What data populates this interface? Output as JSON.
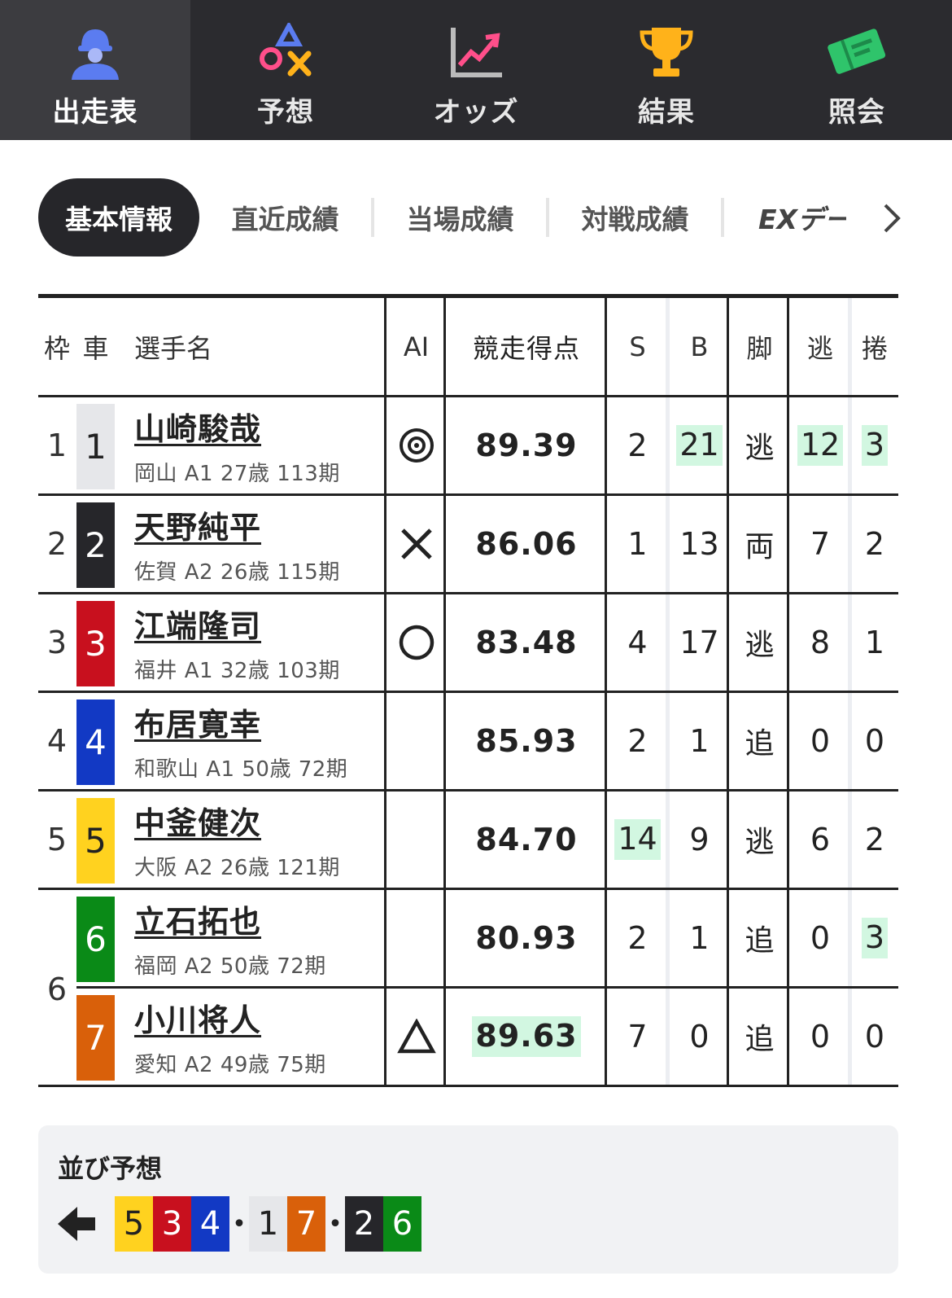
{
  "nav": {
    "items": [
      {
        "label": "出走表",
        "icon": "rider-icon",
        "active": true
      },
      {
        "label": "予想",
        "icon": "prediction-icon",
        "active": false
      },
      {
        "label": "オッズ",
        "icon": "odds-chart-icon",
        "active": false
      },
      {
        "label": "結果",
        "icon": "trophy-icon",
        "active": false
      },
      {
        "label": "照会",
        "icon": "ticket-icon",
        "active": false
      }
    ]
  },
  "subtabs": {
    "items": [
      "基本情報",
      "直近成績",
      "当場成績",
      "対戦成績",
      "EXデー"
    ],
    "active": "基本情報",
    "next_icon": "chevron-right-icon"
  },
  "table": {
    "headers": {
      "waku": "枠",
      "sha": "車",
      "name": "選手名",
      "ai": "AI",
      "score": "競走得点",
      "s": "S",
      "b": "B",
      "kyaku": "脚",
      "nige": "逃",
      "makuri": "捲"
    },
    "rows": [
      {
        "waku": "1",
        "sha": "1",
        "sha_bg": "#e6e7ea",
        "sha_fg": "#222222",
        "name": "山崎駿哉",
        "info": "岡山 A1 27歳 113期",
        "ai": "double-circle",
        "score": "89.39",
        "s": "2",
        "b": "21",
        "kyaku": "逃",
        "nige": "12",
        "makuri": "3",
        "hl": [
          "b",
          "nige",
          "makuri"
        ]
      },
      {
        "waku": "2",
        "sha": "2",
        "sha_bg": "#26262a",
        "sha_fg": "#ffffff",
        "name": "天野純平",
        "info": "佐賀 A2 26歳 115期",
        "ai": "cross",
        "score": "86.06",
        "s": "1",
        "b": "13",
        "kyaku": "両",
        "nige": "7",
        "makuri": "2",
        "hl": []
      },
      {
        "waku": "3",
        "sha": "3",
        "sha_bg": "#c8101e",
        "sha_fg": "#ffffff",
        "name": "江端隆司",
        "info": "福井 A1 32歳 103期",
        "ai": "circle",
        "score": "83.48",
        "s": "4",
        "b": "17",
        "kyaku": "逃",
        "nige": "8",
        "makuri": "1",
        "hl": []
      },
      {
        "waku": "4",
        "sha": "4",
        "sha_bg": "#1239c4",
        "sha_fg": "#ffffff",
        "name": "布居寛幸",
        "info": "和歌山 A1 50歳 72期",
        "ai": "",
        "score": "85.93",
        "s": "2",
        "b": "1",
        "kyaku": "追",
        "nige": "0",
        "makuri": "0",
        "hl": []
      },
      {
        "waku": "5",
        "sha": "5",
        "sha_bg": "#ffd21f",
        "sha_fg": "#222222",
        "name": "中釜健次",
        "info": "大阪 A2 26歳 121期",
        "ai": "",
        "score": "84.70",
        "s": "14",
        "b": "9",
        "kyaku": "逃",
        "nige": "6",
        "makuri": "2",
        "hl": [
          "s"
        ]
      },
      {
        "waku": "6",
        "sha": "6",
        "sha_bg": "#0a8a17",
        "sha_fg": "#ffffff",
        "name": "立石拓也",
        "info": "福岡 A2 50歳 72期",
        "ai": "",
        "score": "80.93",
        "s": "2",
        "b": "1",
        "kyaku": "追",
        "nige": "0",
        "makuri": "3",
        "hl": [
          "makuri"
        ]
      },
      {
        "waku": "",
        "sha": "7",
        "sha_bg": "#d9600a",
        "sha_fg": "#ffffff",
        "name": "小川将人",
        "info": "愛知 A2 49歳 75期",
        "ai": "triangle",
        "score": "89.63",
        "s": "7",
        "b": "0",
        "kyaku": "追",
        "nige": "0",
        "makuri": "0",
        "hl": [
          "score"
        ]
      }
    ],
    "waku6_label": "6"
  },
  "narabi": {
    "title": "並び予想",
    "direction_icon": "arrow-left-icon",
    "groups": [
      [
        {
          "n": "5",
          "bg": "#ffd21f",
          "fg": "#222222"
        },
        {
          "n": "3",
          "bg": "#c8101e",
          "fg": "#ffffff"
        },
        {
          "n": "4",
          "bg": "#1239c4",
          "fg": "#ffffff"
        }
      ],
      [
        {
          "n": "1",
          "bg": "#e6e7ea",
          "fg": "#222222"
        },
        {
          "n": "7",
          "bg": "#d9600a",
          "fg": "#ffffff"
        }
      ],
      [
        {
          "n": "2",
          "bg": "#26262a",
          "fg": "#ffffff"
        },
        {
          "n": "6",
          "bg": "#0a8a17",
          "fg": "#ffffff"
        }
      ]
    ],
    "separator": "•"
  }
}
